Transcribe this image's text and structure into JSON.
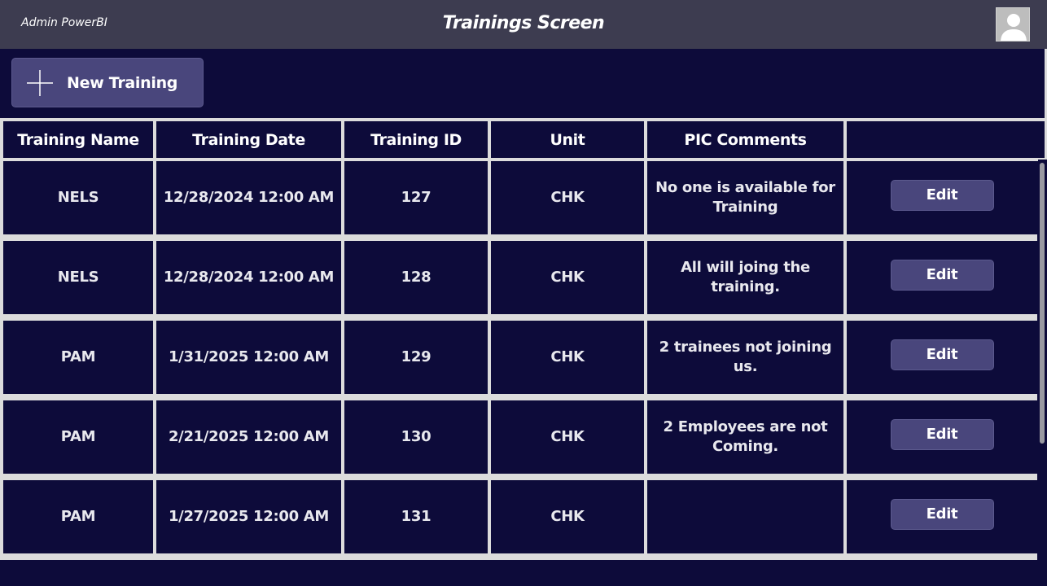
{
  "header": {
    "app_name": "Admin PowerBI",
    "title": "Trainings Screen",
    "avatar_icon": "user-avatar-icon"
  },
  "toolbar": {
    "new_training_label": "New Training",
    "new_training_icon": "plus-icon"
  },
  "table": {
    "columns": [
      "Training Name",
      "Training Date",
      "Training ID",
      "Unit",
      "PIC Comments",
      ""
    ],
    "rows": [
      {
        "name": "NELS",
        "date": "12/28/2024 12:00 AM",
        "id": "127",
        "unit": "CHK",
        "comment": "No one is available for Training",
        "action": "Edit"
      },
      {
        "name": "NELS",
        "date": "12/28/2024 12:00 AM",
        "id": "128",
        "unit": "CHK",
        "comment": "All will joing the training.",
        "action": "Edit"
      },
      {
        "name": "PAM",
        "date": "1/31/2025 12:00 AM",
        "id": "129",
        "unit": "CHK",
        "comment": "2 trainees not joining us.",
        "action": "Edit"
      },
      {
        "name": "PAM",
        "date": "2/21/2025 12:00 AM",
        "id": "130",
        "unit": "CHK",
        "comment": "2 Employees are not Coming.",
        "action": "Edit"
      },
      {
        "name": "PAM",
        "date": "1/27/2025 12:00 AM",
        "id": "131",
        "unit": "CHK",
        "comment": "",
        "action": "Edit"
      }
    ]
  },
  "colors": {
    "background": "#0d0b3a",
    "header_bar": "#3d3c50",
    "button": "#49467c",
    "grid_lines": "#dcdcdc"
  }
}
